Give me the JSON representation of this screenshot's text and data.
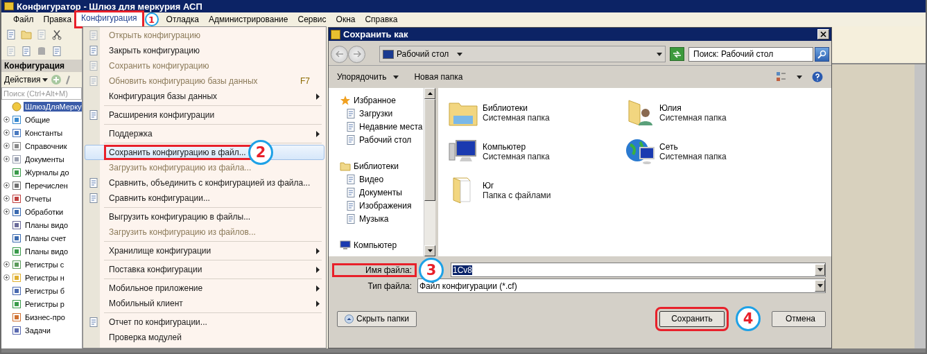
{
  "app": {
    "title": "Конфигуратор - Шлюз для меркурия АСП"
  },
  "menubar": [
    {
      "label": "Файл",
      "selected": false
    },
    {
      "label": "Правка",
      "selected": false
    },
    {
      "label": "Конфигурация",
      "selected": true,
      "callout": "1"
    },
    {
      "label": "Отладка",
      "selected": false
    },
    {
      "label": "Администрирование",
      "selected": false
    },
    {
      "label": "Сервис",
      "selected": false
    },
    {
      "label": "Окна",
      "selected": false
    },
    {
      "label": "Справка",
      "selected": false
    }
  ],
  "sidebar": {
    "title": "Конфигурация",
    "actions": "Действия",
    "search_placeholder": "Поиск (Ctrl+Alt+M)",
    "tree": [
      {
        "label": "ШлюзДляМерку",
        "selected": true,
        "expandable": false
      },
      {
        "label": "Общие",
        "selected": false,
        "expandable": true
      },
      {
        "label": "Константы",
        "selected": false,
        "expandable": true
      },
      {
        "label": "Справочник",
        "selected": false,
        "expandable": true
      },
      {
        "label": "Документы",
        "selected": false,
        "expandable": true
      },
      {
        "label": "Журналы до",
        "selected": false,
        "expandable": false
      },
      {
        "label": "Перечислен",
        "selected": false,
        "expandable": true
      },
      {
        "label": "Отчеты",
        "selected": false,
        "expandable": true
      },
      {
        "label": "Обработки",
        "selected": false,
        "expandable": true
      },
      {
        "label": "Планы видо",
        "selected": false,
        "expandable": false
      },
      {
        "label": "Планы счет",
        "selected": false,
        "expandable": false
      },
      {
        "label": "Планы видо",
        "selected": false,
        "expandable": false
      },
      {
        "label": "Регистры с",
        "selected": false,
        "expandable": true
      },
      {
        "label": "Регистры н",
        "selected": false,
        "expandable": true
      },
      {
        "label": "Регистры б",
        "selected": false,
        "expandable": false
      },
      {
        "label": "Регистры р",
        "selected": false,
        "expandable": false
      },
      {
        "label": "Бизнес-про",
        "selected": false,
        "expandable": false
      },
      {
        "label": "Задачи",
        "selected": false,
        "expandable": false
      }
    ]
  },
  "menu": {
    "items": [
      {
        "kind": "item",
        "label": "Открыть конфигурацию",
        "disabled": true,
        "icon": true,
        "selected": false
      },
      {
        "kind": "item",
        "label": "Закрыть конфигурацию",
        "disabled": false,
        "icon": true,
        "selected": false
      },
      {
        "kind": "item",
        "label": "Сохранить конфигурацию",
        "disabled": true,
        "icon": true,
        "selected": false
      },
      {
        "kind": "item",
        "label": "Обновить конфигурацию базы данных",
        "disabled": true,
        "icon": true,
        "selected": false,
        "shortcut": "F7"
      },
      {
        "kind": "item",
        "label": "Конфигурация базы данных",
        "disabled": false,
        "selected": false,
        "submenu": true
      },
      {
        "kind": "separator"
      },
      {
        "kind": "item",
        "label": "Расширения конфигурации",
        "disabled": false,
        "icon": true,
        "selected": false
      },
      {
        "kind": "separator"
      },
      {
        "kind": "item",
        "label": "Поддержка",
        "disabled": false,
        "selected": false,
        "submenu": true
      },
      {
        "kind": "separator"
      },
      {
        "kind": "item",
        "label": "Сохранить конфигурацию в файл...",
        "disabled": false,
        "selected": true,
        "callout": "2"
      },
      {
        "kind": "item",
        "label": "Загрузить конфигурацию из файла...",
        "disabled": true,
        "selected": false
      },
      {
        "kind": "item",
        "label": "Сравнить, объединить с конфигурацией из файла...",
        "disabled": false,
        "icon": true,
        "selected": false
      },
      {
        "kind": "item",
        "label": "Сравнить конфигурации...",
        "disabled": false,
        "icon": true,
        "selected": false
      },
      {
        "kind": "separator"
      },
      {
        "kind": "item",
        "label": "Выгрузить конфигурацию в файлы...",
        "disabled": false,
        "selected": false
      },
      {
        "kind": "item",
        "label": "Загрузить конфигурацию из файлов...",
        "disabled": true,
        "selected": false
      },
      {
        "kind": "separator"
      },
      {
        "kind": "item",
        "label": "Хранилище конфигурации",
        "disabled": false,
        "selected": false,
        "submenu": true
      },
      {
        "kind": "separator"
      },
      {
        "kind": "item",
        "label": "Поставка конфигурации",
        "disabled": false,
        "selected": false,
        "submenu": true
      },
      {
        "kind": "separator"
      },
      {
        "kind": "item",
        "label": "Мобильное приложение",
        "disabled": false,
        "selected": false,
        "submenu": true
      },
      {
        "kind": "item",
        "label": "Мобильный клиент",
        "disabled": false,
        "selected": false,
        "submenu": true
      },
      {
        "kind": "separator"
      },
      {
        "kind": "item",
        "label": "Отчет по конфигурации...",
        "disabled": false,
        "icon": true,
        "selected": false
      },
      {
        "kind": "item",
        "label": "Проверка модулей",
        "disabled": false,
        "selected": false
      }
    ]
  },
  "dialog": {
    "title": "Сохранить как",
    "location": "Рабочий стол",
    "search_placeholder": "Поиск: Рабочий стол",
    "toolbar": [
      {
        "label": "Упорядочить",
        "dropdown": true
      },
      {
        "label": "Новая папка",
        "dropdown": false
      }
    ],
    "nav": [
      {
        "label": "Избранное",
        "selected": false,
        "children": [
          {
            "label": "Загрузки",
            "selected": false
          },
          {
            "label": "Недавние места",
            "selected": false
          },
          {
            "label": "Рабочий стол",
            "selected": false
          }
        ]
      },
      {
        "label": "Библиотеки",
        "selected": false,
        "children": [
          {
            "label": "Видео",
            "selected": false
          },
          {
            "label": "Документы",
            "selected": false
          },
          {
            "label": "Изображения",
            "selected": false
          },
          {
            "label": "Музыка",
            "selected": false
          }
        ]
      },
      {
        "label": "Компьютер",
        "selected": false
      }
    ],
    "items": [
      {
        "kind": "library",
        "name": "Библиотеки",
        "type": "Системная папка"
      },
      {
        "kind": "user",
        "name": "Юлия",
        "type": "Системная папка"
      },
      {
        "kind": "computer",
        "name": "Компьютер",
        "type": "Системная папка"
      },
      {
        "kind": "network",
        "name": "Сеть",
        "type": "Системная папка"
      },
      {
        "kind": "folder",
        "name": "Юг",
        "type": "Папка с файлами"
      }
    ],
    "file_name": {
      "label": "Имя файла:",
      "value": "1Cv8",
      "callout": "3"
    },
    "file_type": {
      "label": "Тип файла:",
      "value": "Файл конфигурации (*.cf)"
    },
    "buttons": [
      {
        "kind": "toggle",
        "label": "Скрыть папки"
      },
      {
        "kind": "primary",
        "label": "Сохранить",
        "callout": "4"
      },
      {
        "kind": "secondary",
        "label": "Отмена"
      }
    ]
  }
}
